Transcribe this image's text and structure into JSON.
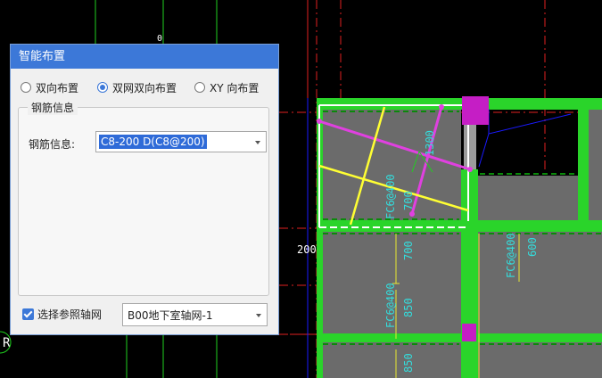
{
  "cad": {
    "dims": [
      "1300",
      "700",
      "700",
      "600",
      "850",
      "850",
      "200"
    ],
    "labels": [
      "FC6@400",
      "FC6@400",
      "FC6@400"
    ],
    "axis_label": "R",
    "small_marker": "0"
  },
  "dialog": {
    "title": "智能布置",
    "radios": [
      {
        "label": "双向布置",
        "checked": false
      },
      {
        "label": "双网双向布置",
        "checked": true
      },
      {
        "label": "XY 向布置",
        "checked": false
      }
    ],
    "group_title": "钢筋信息",
    "rebar_label": "钢筋信息:",
    "rebar_value": "C8-200 D(C8@200)",
    "ref_axis_label": "选择参照轴网",
    "ref_axis_checked": true,
    "axis_value": "B00地下室轴网-1"
  }
}
